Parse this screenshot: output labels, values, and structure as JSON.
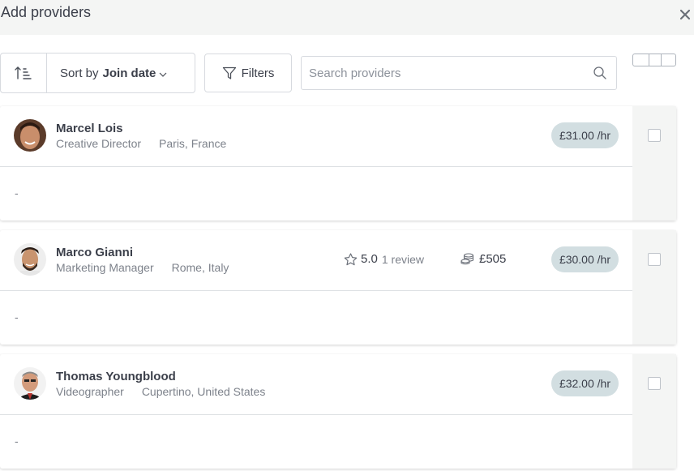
{
  "header": {
    "title": "Add providers",
    "close_icon": "close-icon"
  },
  "toolbar": {
    "sort_order_icon": "sort-ascending-icon",
    "sort_prefix": "Sort by",
    "sort_value": "Join date",
    "filters_label": "Filters",
    "search_placeholder": "Search providers",
    "search_value": ""
  },
  "colors": {
    "header_bg": "#f4f5f4",
    "rate_badge": "#d2dee1",
    "text": "#3b3f4a",
    "muted": "#7d828b"
  },
  "providers": [
    {
      "name": "Marcel Lois",
      "role": "Creative Director",
      "location": "Paris, France",
      "rating": "",
      "reviews": "",
      "earned": "",
      "rate": "£31.00 /hr",
      "description": "-",
      "selected": false
    },
    {
      "name": "Marco Gianni",
      "role": "Marketing Manager",
      "location": "Rome, Italy",
      "rating": "5.0",
      "reviews": "1 review",
      "earned": "£505",
      "rate": "£30.00 /hr",
      "description": "-",
      "selected": false
    },
    {
      "name": "Thomas Youngblood",
      "role": "Videographer",
      "location": "Cupertino, United States",
      "rating": "",
      "reviews": "",
      "earned": "",
      "rate": "£32.00 /hr",
      "description": "-",
      "selected": false
    }
  ]
}
